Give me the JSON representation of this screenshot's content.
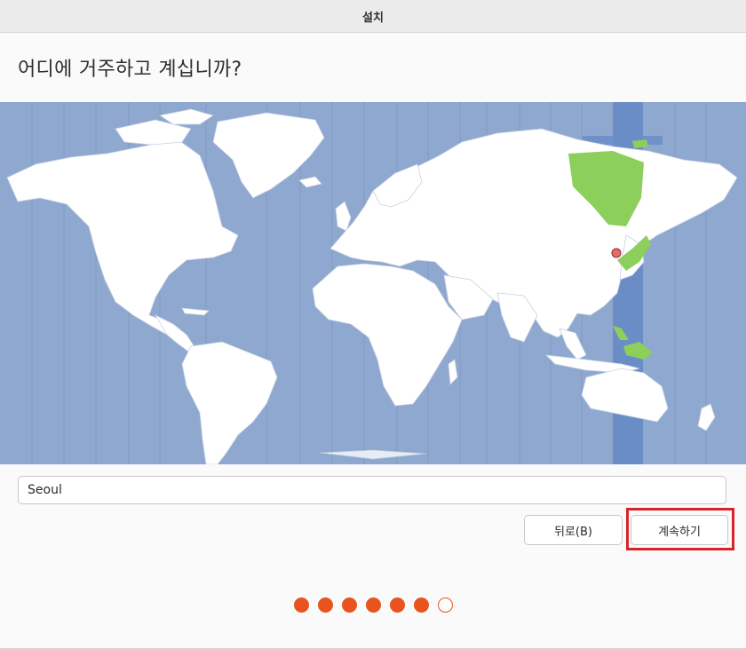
{
  "window": {
    "title": "설치"
  },
  "heading": "어디에 거주하고 계십니까?",
  "timezone_input": {
    "value": "Seoul"
  },
  "buttons": {
    "back_label": "뒤로(B)",
    "continue_label": "계속하기"
  },
  "progress": {
    "total_steps": 7,
    "completed_steps": 6
  },
  "map": {
    "selected_city": "Seoul",
    "colors": {
      "ocean": "#8fa8cf",
      "land": "#ffffff",
      "selected_zone_band": "#6b8dc6",
      "selected_zone_land": "#8ccf5a",
      "marker": "#e86b6b"
    }
  },
  "colors": {
    "accent": "#e9531d",
    "highlight_box": "#d8232a"
  }
}
